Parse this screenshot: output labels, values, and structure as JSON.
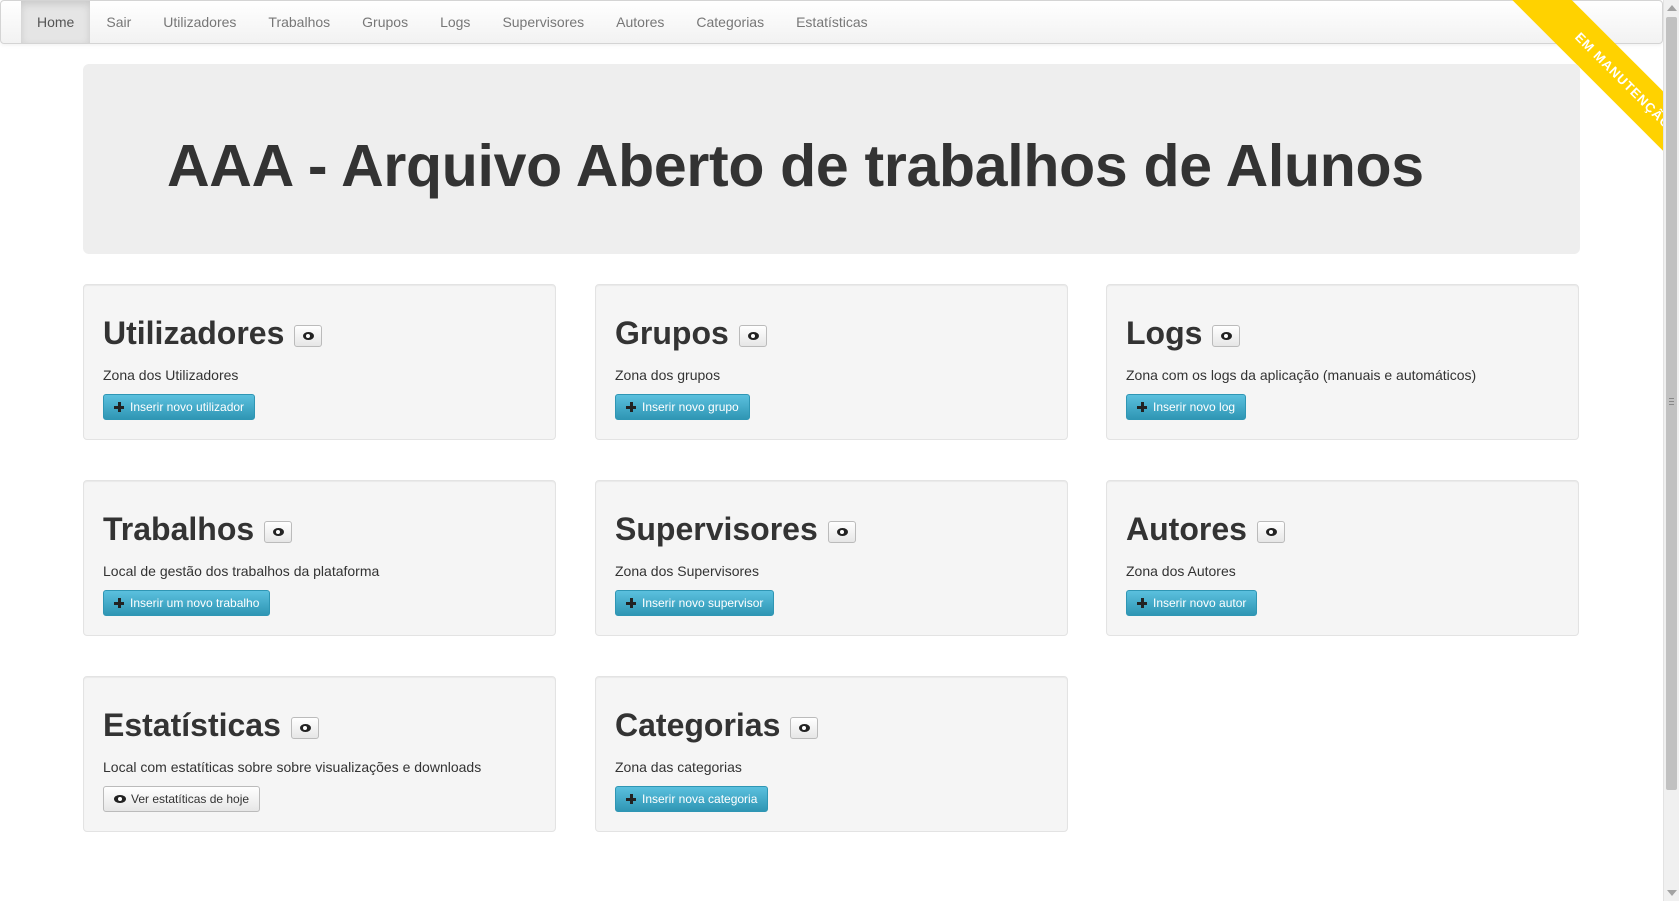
{
  "nav": {
    "items": [
      {
        "label": "Home",
        "active": true
      },
      {
        "label": "Sair"
      },
      {
        "label": "Utilizadores"
      },
      {
        "label": "Trabalhos"
      },
      {
        "label": "Grupos"
      },
      {
        "label": "Logs"
      },
      {
        "label": "Supervisores"
      },
      {
        "label": "Autores"
      },
      {
        "label": "Categorias"
      },
      {
        "label": "Estatísticas"
      }
    ]
  },
  "ribbon": {
    "text": "EM MANUTENÇÃO",
    "color": "#ffd200"
  },
  "hero": {
    "title": "AAA - Arquivo Aberto de trabalhos de Alunos"
  },
  "cards": [
    {
      "title": "Utilizadores",
      "description": "Zona dos Utilizadores",
      "button": "Inserir novo utilizador",
      "button_icon": "plus-icon"
    },
    {
      "title": "Grupos",
      "description": "Zona dos grupos",
      "button": "Inserir novo grupo",
      "button_icon": "plus-icon"
    },
    {
      "title": "Logs",
      "description": "Zona com os logs da aplicação (manuais e automáticos)",
      "button": "Inserir novo log",
      "button_icon": "plus-icon"
    },
    {
      "title": "Trabalhos",
      "description": "Local de gestão dos trabalhos da plataforma",
      "button": "Inserir um novo trabalho",
      "button_icon": "plus-icon"
    },
    {
      "title": "Supervisores",
      "description": "Zona dos Supervisores",
      "button": "Inserir novo supervisor",
      "button_icon": "plus-icon"
    },
    {
      "title": "Autores",
      "description": "Zona dos Autores",
      "button": "Inserir novo autor",
      "button_icon": "plus-icon"
    },
    {
      "title": "Estatísticas",
      "description": "Local com estatíticas sobre sobre visualizações e downloads",
      "button": "Ver estatíticas de hoje",
      "button_icon": "eye-icon"
    },
    {
      "title": "Categorias",
      "description": "Zona das categorias",
      "button": "Inserir nova categoria",
      "button_icon": "plus-icon"
    }
  ],
  "colors": {
    "primary_button": "#49afcd",
    "hero_bg": "#eeeeee",
    "card_bg": "#f5f5f5"
  }
}
